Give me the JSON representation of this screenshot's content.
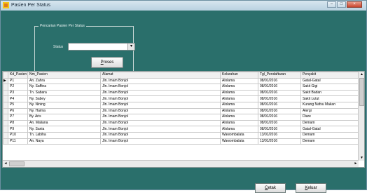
{
  "window": {
    "title": "Pasien Per Status",
    "minimize": "–",
    "maximize": "□",
    "close": "×"
  },
  "filter": {
    "group_title": "Pencarian Pasien Per Status",
    "status_label": "Status",
    "status_value": "",
    "proses_label_u": "P",
    "proses_label_rest": "roses"
  },
  "grid": {
    "columns": [
      "Kd_Pasien",
      "Nm_Pasien",
      "Alamat",
      "Kelurahan",
      "Tgl_Pendaftaran",
      "Penyakit"
    ],
    "rows": [
      [
        "P1",
        "An. Zahra",
        "Jln. Imam Bonjol",
        "Alolama",
        "08/01/2016",
        "Gatal-Gatal"
      ],
      [
        "P2",
        "Ny. Saffina",
        "Jln. Imam Bonjol",
        "Alolama",
        "08/01/2016",
        "Sakit Gigi"
      ],
      [
        "P3",
        "Tn. Sabara",
        "Jln. Imam Bonjol",
        "Alolama",
        "08/01/2016",
        "Sakit Badan"
      ],
      [
        "P4",
        "Ny. Sabey",
        "Jln. Imam Bonjol",
        "Alolama",
        "08/01/2016",
        "Sakit Lutut"
      ],
      [
        "P5",
        "Ny. Nining",
        "Jln. Imam Bonjol",
        "Alolama",
        "08/01/2016",
        "Kurang Nafsu Makan"
      ],
      [
        "P6",
        "Ny. Haima",
        "Jln. Imam Bonjol",
        "Alolama",
        "08/01/2016",
        "Alergi"
      ],
      [
        "P7",
        "By. Aris",
        "Jln. Imam Bonjol",
        "Alolama",
        "08/01/2016",
        "Diare"
      ],
      [
        "P8",
        "An. Maliana",
        "Jln. Imam Bonjol",
        "Alolama",
        "08/01/2016",
        "Demam"
      ],
      [
        "P9",
        "Ny. Sania",
        "Jln. Imam Bonjol",
        "Alolama",
        "08/01/2016",
        "Gatal-Gatal"
      ],
      [
        "P10",
        "Tn. Labiha",
        "Jln. Imam Bonjol",
        "Wawombalata",
        "13/01/2016",
        "Demam"
      ],
      [
        "P11",
        "An. Naya",
        "Jln. Imam Bonjol",
        "Wawombalata",
        "13/01/2016",
        "Demam"
      ]
    ],
    "current_row_indicator": "▶",
    "scroll_up": "▲",
    "scroll_down": "▼",
    "scroll_left": "◄",
    "scroll_right": "►"
  },
  "footer": {
    "cetak_u": "C",
    "cetak_rest": "etak",
    "keluar_u": "K",
    "keluar_rest": "eluar"
  },
  "colors": {
    "window_bg": "#2a6f6b",
    "grid_bg": "#ffffff"
  },
  "icons": {
    "app": "app-icon"
  }
}
